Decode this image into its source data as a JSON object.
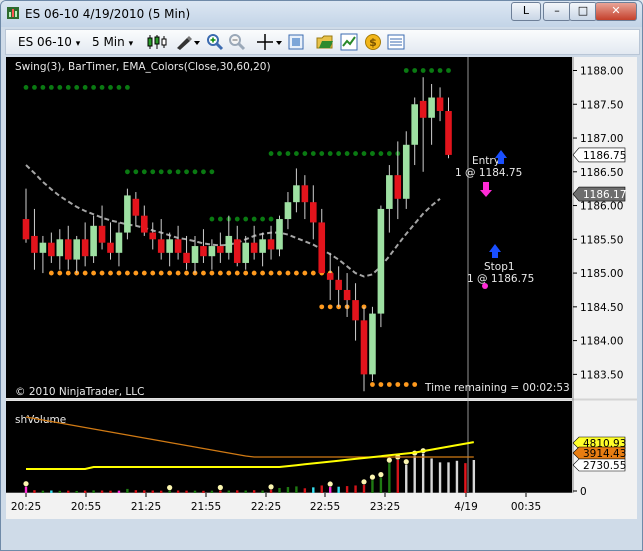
{
  "window": {
    "title": "ES 06-10  4/19/2010 (5 Min)",
    "btn_link": "L",
    "btn_min": "–",
    "btn_max": "□",
    "btn_close": "✕"
  },
  "toolbar": {
    "instrument": "ES 06-10",
    "interval": "5 Min",
    "dropdown_glyph": "▾",
    "icons": [
      "candles-icon",
      "draw-pen-icon",
      "zoom-in-icon",
      "zoom-out-icon",
      "crosshair-icon",
      "properties-icon",
      "folder-icon",
      "chart-trader-icon",
      "coin-icon",
      "data-box-icon"
    ]
  },
  "panel": {
    "indicators": "Swing(3), BarTimer, EMA_Colors(Close,30,60,20)",
    "copyright": "© 2010 NinjaTrader, LLC",
    "timer": "Time remaining = 00:02:53",
    "entry_label": "Entry",
    "entry_qty": "1 @ 1184.75",
    "stop_label": "Stop1",
    "stop_qty": "1 @ 1186.75",
    "volume_title": "shVolume"
  },
  "colors": {
    "bull": "#9ee0a2",
    "bear": "#e3141c",
    "swing_high": "#0a7a12",
    "swing_low": "#ff9a1e",
    "ema": "#a5a5a5",
    "vol_avg_yellow": "#ffff00",
    "vol_avg_orange": "#d07a14"
  },
  "chart_data": {
    "type": "candlestick",
    "interval": "5 Min",
    "price_axis": {
      "ticks": [
        "1188.00",
        "1187.50",
        "1187.00",
        "1186.50",
        "1186.00",
        "1185.50",
        "1185.00",
        "1184.50",
        "1184.00",
        "1183.50"
      ],
      "range": [
        1183.15,
        1188.2
      ],
      "markers": [
        {
          "label": "1186.75",
          "style": "white"
        },
        {
          "label": "1186.17",
          "style": "gray"
        }
      ]
    },
    "volume_axis": {
      "ticks": [
        "0"
      ],
      "markers": [
        {
          "label": "4810.93",
          "style": "yellow"
        },
        {
          "label": "3914.43",
          "style": "orange"
        },
        {
          "label": "2730.55",
          "style": "white"
        }
      ],
      "range": [
        0,
        5600
      ]
    },
    "time_ticks": [
      "20:25",
      "20:55",
      "21:25",
      "21:55",
      "22:25",
      "22:55",
      "23:25",
      "4/19",
      "00:35"
    ],
    "bars": [
      [
        1185.8,
        1186.25,
        1185.45,
        1185.5
      ],
      [
        1185.55,
        1185.95,
        1185.05,
        1185.3
      ],
      [
        1185.3,
        1185.55,
        1185.0,
        1185.45
      ],
      [
        1185.45,
        1185.6,
        1185.15,
        1185.25
      ],
      [
        1185.25,
        1185.65,
        1185.05,
        1185.5
      ],
      [
        1185.5,
        1185.7,
        1185.05,
        1185.2
      ],
      [
        1185.2,
        1185.55,
        1185.0,
        1185.5
      ],
      [
        1185.5,
        1185.75,
        1185.1,
        1185.25
      ],
      [
        1185.25,
        1185.85,
        1185.15,
        1185.7
      ],
      [
        1185.7,
        1186.0,
        1185.35,
        1185.45
      ],
      [
        1185.45,
        1185.75,
        1185.2,
        1185.3
      ],
      [
        1185.3,
        1185.75,
        1185.1,
        1185.6
      ],
      [
        1185.6,
        1186.25,
        1185.5,
        1186.15
      ],
      [
        1186.1,
        1186.2,
        1185.7,
        1185.85
      ],
      [
        1185.85,
        1186.0,
        1185.55,
        1185.6
      ],
      [
        1185.6,
        1185.75,
        1185.35,
        1185.5
      ],
      [
        1185.5,
        1185.8,
        1185.2,
        1185.3
      ],
      [
        1185.3,
        1185.6,
        1185.1,
        1185.5
      ],
      [
        1185.5,
        1185.7,
        1185.2,
        1185.3
      ],
      [
        1185.3,
        1185.55,
        1185.05,
        1185.15
      ],
      [
        1185.15,
        1185.55,
        1185.0,
        1185.4
      ],
      [
        1185.4,
        1185.65,
        1185.15,
        1185.25
      ],
      [
        1185.25,
        1185.5,
        1185.05,
        1185.4
      ],
      [
        1185.4,
        1185.6,
        1185.15,
        1185.3
      ],
      [
        1185.3,
        1185.85,
        1185.2,
        1185.55
      ],
      [
        1185.5,
        1185.7,
        1185.1,
        1185.15
      ],
      [
        1185.15,
        1185.55,
        1185.05,
        1185.45
      ],
      [
        1185.45,
        1185.7,
        1185.2,
        1185.3
      ],
      [
        1185.3,
        1185.6,
        1185.1,
        1185.5
      ],
      [
        1185.5,
        1185.7,
        1185.2,
        1185.35
      ],
      [
        1185.35,
        1185.85,
        1185.25,
        1185.8
      ],
      [
        1185.8,
        1186.2,
        1185.65,
        1186.05
      ],
      [
        1186.05,
        1186.55,
        1185.9,
        1186.3
      ],
      [
        1186.3,
        1186.45,
        1185.8,
        1186.05
      ],
      [
        1186.05,
        1186.3,
        1185.5,
        1185.75
      ],
      [
        1185.75,
        1185.95,
        1185.1,
        1185.0
      ],
      [
        1185.0,
        1185.3,
        1184.6,
        1184.9
      ],
      [
        1184.9,
        1185.1,
        1184.5,
        1184.75
      ],
      [
        1184.75,
        1185.0,
        1184.35,
        1184.6
      ],
      [
        1184.6,
        1184.85,
        1184.0,
        1184.3
      ],
      [
        1184.3,
        1184.5,
        1183.25,
        1183.5
      ],
      [
        1183.5,
        1184.5,
        1183.4,
        1184.4
      ],
      [
        1184.4,
        1186.0,
        1184.2,
        1185.95
      ],
      [
        1185.95,
        1186.6,
        1185.6,
        1186.45
      ],
      [
        1186.45,
        1186.95,
        1185.8,
        1186.1
      ],
      [
        1186.1,
        1187.1,
        1185.95,
        1186.9
      ],
      [
        1186.9,
        1187.6,
        1186.6,
        1187.5
      ],
      [
        1187.55,
        1187.9,
        1186.5,
        1187.3
      ],
      [
        1187.3,
        1187.8,
        1186.9,
        1187.6
      ],
      [
        1187.6,
        1187.75,
        1187.25,
        1187.4
      ],
      [
        1187.4,
        1187.6,
        1186.7,
        1186.75
      ]
    ],
    "volumes": [
      400,
      180,
      150,
      160,
      140,
      150,
      130,
      150,
      170,
      160,
      150,
      150,
      260,
      180,
      170,
      160,
      150,
      150,
      160,
      150,
      150,
      140,
      150,
      160,
      160,
      170,
      160,
      180,
      160,
      200,
      320,
      380,
      420,
      300,
      360,
      480,
      380,
      400,
      440,
      480,
      520,
      820,
      980,
      1900,
      2100,
      1800,
      2350,
      2500,
      2200,
      1950,
      1950,
      2050,
      1900,
      2100
    ],
    "swing_high_segments": [
      {
        "from": 0,
        "to": 12,
        "price": 1187.75
      },
      {
        "from": 12,
        "to": 22,
        "price": 1186.5
      },
      {
        "from": 22,
        "to": 29,
        "price": 1185.8
      },
      {
        "from": 29,
        "to": 41,
        "price": 1186.77
      },
      {
        "from": 41,
        "to": 45,
        "price": 1186.77
      },
      {
        "from": 45,
        "to": 50,
        "price": 1188.0
      }
    ],
    "swing_low_segments": [
      {
        "from": 3,
        "to": 36,
        "price": 1185.0
      },
      {
        "from": 35,
        "to": 40,
        "price": 1184.5
      },
      {
        "from": 41,
        "to": 46,
        "price": 1183.35
      }
    ],
    "ema_points": [
      [
        1186.6,
        1186.48,
        1186.35,
        1186.24,
        1186.14,
        1186.06,
        1185.98,
        1185.92,
        1185.87,
        1185.82,
        1185.78,
        1185.75,
        1185.72,
        1185.7,
        1185.67,
        1185.63,
        1185.6,
        1185.56,
        1185.52,
        1185.5,
        1185.47,
        1185.44,
        1185.42,
        1185.41,
        1185.42,
        1185.45,
        1185.5,
        1185.55,
        1185.58,
        1185.6,
        1185.6,
        1185.57,
        1185.52,
        1185.47,
        1185.42,
        1185.35,
        1185.28,
        1185.2,
        1185.1,
        1185.0,
        1184.95,
        1184.98,
        1185.1,
        1185.25,
        1185.42,
        1185.58,
        1185.73,
        1185.88,
        1186.0,
        1186.1
      ]
    ]
  }
}
